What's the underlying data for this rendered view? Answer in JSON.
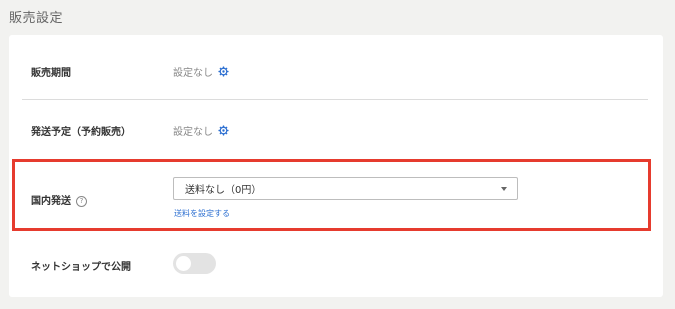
{
  "section": {
    "title": "販売設定"
  },
  "rows": {
    "sales_period": {
      "label": "販売期間",
      "value": "設定なし",
      "icon": "gear-icon"
    },
    "shipping_schedule": {
      "label": "発送予定（予約販売）",
      "value": "設定なし",
      "icon": "gear-icon"
    },
    "domestic_shipping": {
      "label": "国内発送",
      "help_glyph": "?",
      "selected": "送料なし（0円）",
      "link": "送料を設定する"
    },
    "publish_netshop": {
      "label": "ネットショップで公開",
      "enabled": false
    }
  },
  "colors": {
    "accent": "#2c6fd1",
    "highlight": "#e63b2e",
    "toggle_off": "#e3e3e3"
  }
}
